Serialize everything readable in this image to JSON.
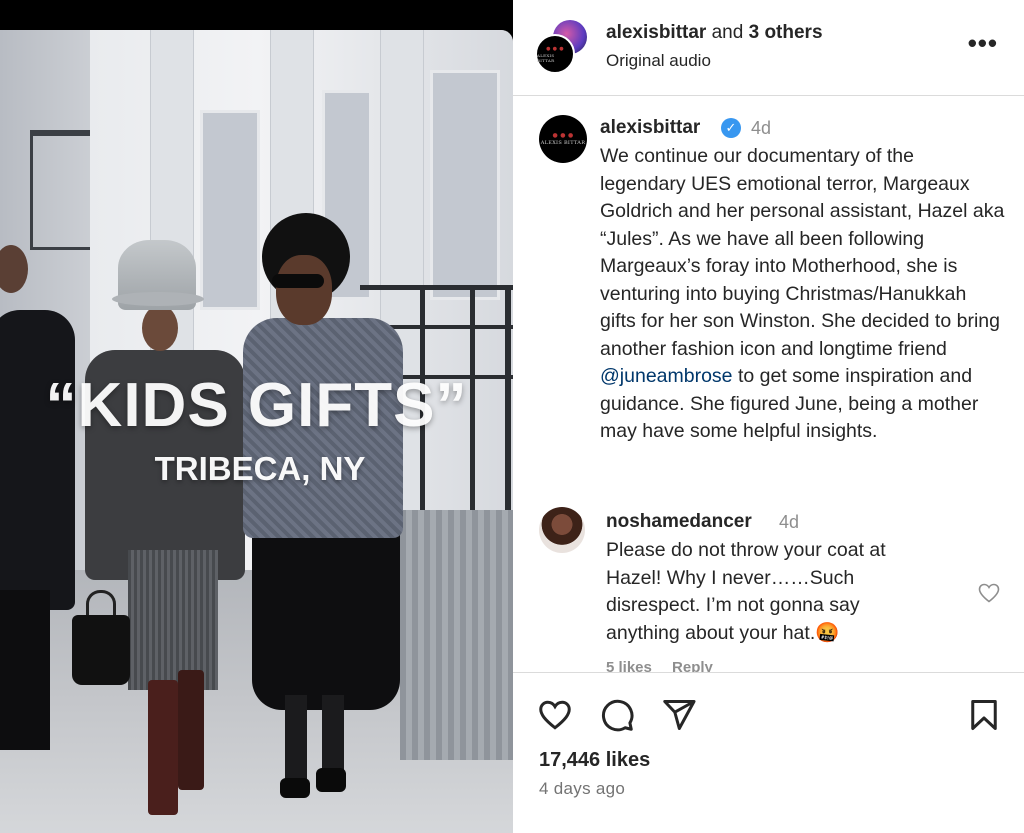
{
  "media": {
    "overlay_title": "“KIDS GIFTS”",
    "overlay_location": "TRIBECA, NY"
  },
  "header": {
    "username": "alexisbittar",
    "collab_connector": "and",
    "collab_others": "3 others",
    "audio": "Original audio",
    "more_icon": "more-horizontal-icon",
    "brand_mark": "ALEXIS BITTAR"
  },
  "caption": {
    "username": "alexisbittar",
    "verified": true,
    "time": "4d",
    "text_before_mention": "We continue our documentary of the legendary UES emotional terror, Margeaux Goldrich and her personal assistant, Hazel aka “Jules”. As we have all been following Margeaux’s foray into Motherhood, she is venturing into buying Christmas/Hanukkah gifts for her son Winston. She decided to bring another fashion icon and longtime friend ",
    "mention": "@juneambrose",
    "text_after_mention": " to get some inspiration and guidance. She figured June, being a mother may have some helpful insights."
  },
  "comment": {
    "username": "noshamedancer",
    "time": "4d",
    "text": "Please do not throw your coat at Hazel! Why I never……Such disrespect. I’m not gonna say anything about your hat.🤬",
    "likes": "5 likes",
    "reply": "Reply"
  },
  "actions": {
    "like_icon": "heart-icon",
    "comment_icon": "comment-bubble-icon",
    "share_icon": "paper-plane-icon",
    "save_icon": "bookmark-icon"
  },
  "footer": {
    "likes": "17,446 likes",
    "time_ago": "4 days ago"
  },
  "colors": {
    "text": "#262626",
    "muted": "#8e8e8e",
    "verified": "#3897f0",
    "mention": "#00376b",
    "divider": "#dbdbdb"
  }
}
